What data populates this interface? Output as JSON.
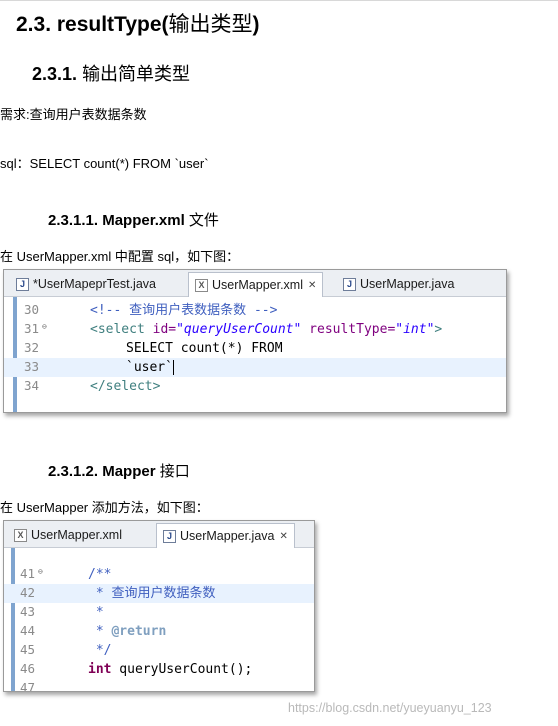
{
  "heading_h2": {
    "number": "2.3. resultType(",
    "cjk": "输出类型",
    "close": ")"
  },
  "heading_h3": {
    "number": "2.3.1.",
    "title": "输出简单类型"
  },
  "requirement": "需求:查询用户表数据条数",
  "sql_line": "sql：SELECT count(*) FROM `user`",
  "section_mapper_xml": {
    "number": "2.3.1.1. Mapper.xml",
    "title": "文件"
  },
  "para_mapper_xml": "在 UserMapper.xml 中配置 sql，如下图：",
  "screenshot1": {
    "tabs": [
      {
        "label": "*UserMapeprTest.java",
        "icon": "java-file-icon",
        "active": false
      },
      {
        "label": "UserMapper.xml",
        "icon": "xml-file-icon",
        "active": true,
        "close": "✕"
      },
      {
        "label": "UserMapper.java",
        "icon": "java-file-icon",
        "active": false
      }
    ],
    "lines": [
      {
        "no": "30",
        "fold": "",
        "comment": "<!-- 查询用户表数据条数 -->"
      },
      {
        "no": "31",
        "fold": "⊖",
        "tag": "<select",
        "attr1": "id=",
        "val1": "\"queryUserCount\"",
        "attr2": "resultType=",
        "val2": "\"int\"",
        "end": ">"
      },
      {
        "no": "32",
        "fold": "",
        "text": "SELECT count(*) FROM"
      },
      {
        "no": "33",
        "fold": "",
        "text": "`user`"
      },
      {
        "no": "34",
        "fold": "",
        "closetag": "</select>"
      }
    ]
  },
  "section_mapper_iface": {
    "number": "2.3.1.2. Mapper",
    "title": "接口"
  },
  "para_mapper_iface": "在 UserMapper 添加方法，如下图：",
  "screenshot2": {
    "tabs": [
      {
        "label": "UserMapper.xml",
        "icon": "xml-file-icon",
        "active": false
      },
      {
        "label": "UserMapper.java",
        "icon": "java-file-icon",
        "active": true,
        "close": "✕"
      }
    ],
    "lines": [
      {
        "no": "41",
        "fold": "⊖",
        "doc": "/**"
      },
      {
        "no": "42",
        "fold": "",
        "doc": " * 查询用户数据条数"
      },
      {
        "no": "43",
        "fold": "",
        "doc": " *"
      },
      {
        "no": "44",
        "fold": "",
        "doc": " * ",
        "doctag": "@return"
      },
      {
        "no": "45",
        "fold": "",
        "doc": " */"
      },
      {
        "no": "46",
        "fold": "",
        "kw": "int",
        "text": " queryUserCount();"
      },
      {
        "no": "47",
        "fold": "",
        "text": ""
      }
    ]
  },
  "watermark": "https://blog.csdn.net/yueyuanyu_123"
}
